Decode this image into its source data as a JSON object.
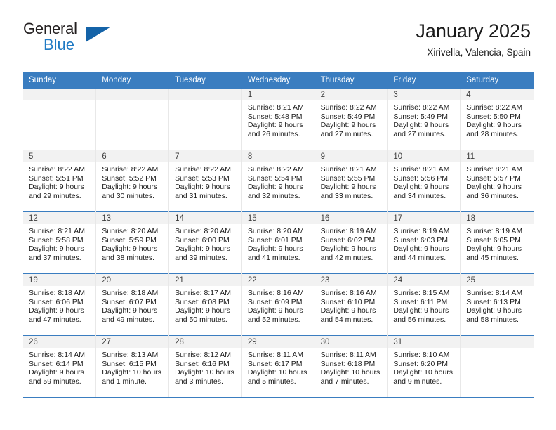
{
  "brand": {
    "name_top": "General",
    "name_bottom": "Blue",
    "accent_color": "#1463a8",
    "text_color": "#231f20"
  },
  "header": {
    "title": "January 2025",
    "location": "Xirivella, Valencia, Spain"
  },
  "theme": {
    "header_bar_color": "#3a7dc0",
    "daynum_band_color": "#f2f2f2",
    "cell_text_color": "#1a1a1a"
  },
  "weekdays": [
    "Sunday",
    "Monday",
    "Tuesday",
    "Wednesday",
    "Thursday",
    "Friday",
    "Saturday"
  ],
  "weeks": [
    [
      {
        "day": "",
        "empty": true
      },
      {
        "day": "",
        "empty": true
      },
      {
        "day": "",
        "empty": true
      },
      {
        "day": "1",
        "sunrise": "Sunrise: 8:21 AM",
        "sunset": "Sunset: 5:48 PM",
        "daylight1": "Daylight: 9 hours",
        "daylight2": "and 26 minutes."
      },
      {
        "day": "2",
        "sunrise": "Sunrise: 8:22 AM",
        "sunset": "Sunset: 5:49 PM",
        "daylight1": "Daylight: 9 hours",
        "daylight2": "and 27 minutes."
      },
      {
        "day": "3",
        "sunrise": "Sunrise: 8:22 AM",
        "sunset": "Sunset: 5:49 PM",
        "daylight1": "Daylight: 9 hours",
        "daylight2": "and 27 minutes."
      },
      {
        "day": "4",
        "sunrise": "Sunrise: 8:22 AM",
        "sunset": "Sunset: 5:50 PM",
        "daylight1": "Daylight: 9 hours",
        "daylight2": "and 28 minutes."
      }
    ],
    [
      {
        "day": "5",
        "sunrise": "Sunrise: 8:22 AM",
        "sunset": "Sunset: 5:51 PM",
        "daylight1": "Daylight: 9 hours",
        "daylight2": "and 29 minutes."
      },
      {
        "day": "6",
        "sunrise": "Sunrise: 8:22 AM",
        "sunset": "Sunset: 5:52 PM",
        "daylight1": "Daylight: 9 hours",
        "daylight2": "and 30 minutes."
      },
      {
        "day": "7",
        "sunrise": "Sunrise: 8:22 AM",
        "sunset": "Sunset: 5:53 PM",
        "daylight1": "Daylight: 9 hours",
        "daylight2": "and 31 minutes."
      },
      {
        "day": "8",
        "sunrise": "Sunrise: 8:22 AM",
        "sunset": "Sunset: 5:54 PM",
        "daylight1": "Daylight: 9 hours",
        "daylight2": "and 32 minutes."
      },
      {
        "day": "9",
        "sunrise": "Sunrise: 8:21 AM",
        "sunset": "Sunset: 5:55 PM",
        "daylight1": "Daylight: 9 hours",
        "daylight2": "and 33 minutes."
      },
      {
        "day": "10",
        "sunrise": "Sunrise: 8:21 AM",
        "sunset": "Sunset: 5:56 PM",
        "daylight1": "Daylight: 9 hours",
        "daylight2": "and 34 minutes."
      },
      {
        "day": "11",
        "sunrise": "Sunrise: 8:21 AM",
        "sunset": "Sunset: 5:57 PM",
        "daylight1": "Daylight: 9 hours",
        "daylight2": "and 36 minutes."
      }
    ],
    [
      {
        "day": "12",
        "sunrise": "Sunrise: 8:21 AM",
        "sunset": "Sunset: 5:58 PM",
        "daylight1": "Daylight: 9 hours",
        "daylight2": "and 37 minutes."
      },
      {
        "day": "13",
        "sunrise": "Sunrise: 8:20 AM",
        "sunset": "Sunset: 5:59 PM",
        "daylight1": "Daylight: 9 hours",
        "daylight2": "and 38 minutes."
      },
      {
        "day": "14",
        "sunrise": "Sunrise: 8:20 AM",
        "sunset": "Sunset: 6:00 PM",
        "daylight1": "Daylight: 9 hours",
        "daylight2": "and 39 minutes."
      },
      {
        "day": "15",
        "sunrise": "Sunrise: 8:20 AM",
        "sunset": "Sunset: 6:01 PM",
        "daylight1": "Daylight: 9 hours",
        "daylight2": "and 41 minutes."
      },
      {
        "day": "16",
        "sunrise": "Sunrise: 8:19 AM",
        "sunset": "Sunset: 6:02 PM",
        "daylight1": "Daylight: 9 hours",
        "daylight2": "and 42 minutes."
      },
      {
        "day": "17",
        "sunrise": "Sunrise: 8:19 AM",
        "sunset": "Sunset: 6:03 PM",
        "daylight1": "Daylight: 9 hours",
        "daylight2": "and 44 minutes."
      },
      {
        "day": "18",
        "sunrise": "Sunrise: 8:19 AM",
        "sunset": "Sunset: 6:05 PM",
        "daylight1": "Daylight: 9 hours",
        "daylight2": "and 45 minutes."
      }
    ],
    [
      {
        "day": "19",
        "sunrise": "Sunrise: 8:18 AM",
        "sunset": "Sunset: 6:06 PM",
        "daylight1": "Daylight: 9 hours",
        "daylight2": "and 47 minutes."
      },
      {
        "day": "20",
        "sunrise": "Sunrise: 8:18 AM",
        "sunset": "Sunset: 6:07 PM",
        "daylight1": "Daylight: 9 hours",
        "daylight2": "and 49 minutes."
      },
      {
        "day": "21",
        "sunrise": "Sunrise: 8:17 AM",
        "sunset": "Sunset: 6:08 PM",
        "daylight1": "Daylight: 9 hours",
        "daylight2": "and 50 minutes."
      },
      {
        "day": "22",
        "sunrise": "Sunrise: 8:16 AM",
        "sunset": "Sunset: 6:09 PM",
        "daylight1": "Daylight: 9 hours",
        "daylight2": "and 52 minutes."
      },
      {
        "day": "23",
        "sunrise": "Sunrise: 8:16 AM",
        "sunset": "Sunset: 6:10 PM",
        "daylight1": "Daylight: 9 hours",
        "daylight2": "and 54 minutes."
      },
      {
        "day": "24",
        "sunrise": "Sunrise: 8:15 AM",
        "sunset": "Sunset: 6:11 PM",
        "daylight1": "Daylight: 9 hours",
        "daylight2": "and 56 minutes."
      },
      {
        "day": "25",
        "sunrise": "Sunrise: 8:14 AM",
        "sunset": "Sunset: 6:13 PM",
        "daylight1": "Daylight: 9 hours",
        "daylight2": "and 58 minutes."
      }
    ],
    [
      {
        "day": "26",
        "sunrise": "Sunrise: 8:14 AM",
        "sunset": "Sunset: 6:14 PM",
        "daylight1": "Daylight: 9 hours",
        "daylight2": "and 59 minutes."
      },
      {
        "day": "27",
        "sunrise": "Sunrise: 8:13 AM",
        "sunset": "Sunset: 6:15 PM",
        "daylight1": "Daylight: 10 hours",
        "daylight2": "and 1 minute."
      },
      {
        "day": "28",
        "sunrise": "Sunrise: 8:12 AM",
        "sunset": "Sunset: 6:16 PM",
        "daylight1": "Daylight: 10 hours",
        "daylight2": "and 3 minutes."
      },
      {
        "day": "29",
        "sunrise": "Sunrise: 8:11 AM",
        "sunset": "Sunset: 6:17 PM",
        "daylight1": "Daylight: 10 hours",
        "daylight2": "and 5 minutes."
      },
      {
        "day": "30",
        "sunrise": "Sunrise: 8:11 AM",
        "sunset": "Sunset: 6:18 PM",
        "daylight1": "Daylight: 10 hours",
        "daylight2": "and 7 minutes."
      },
      {
        "day": "31",
        "sunrise": "Sunrise: 8:10 AM",
        "sunset": "Sunset: 6:20 PM",
        "daylight1": "Daylight: 10 hours",
        "daylight2": "and 9 minutes."
      },
      {
        "day": "",
        "empty": true
      }
    ]
  ]
}
